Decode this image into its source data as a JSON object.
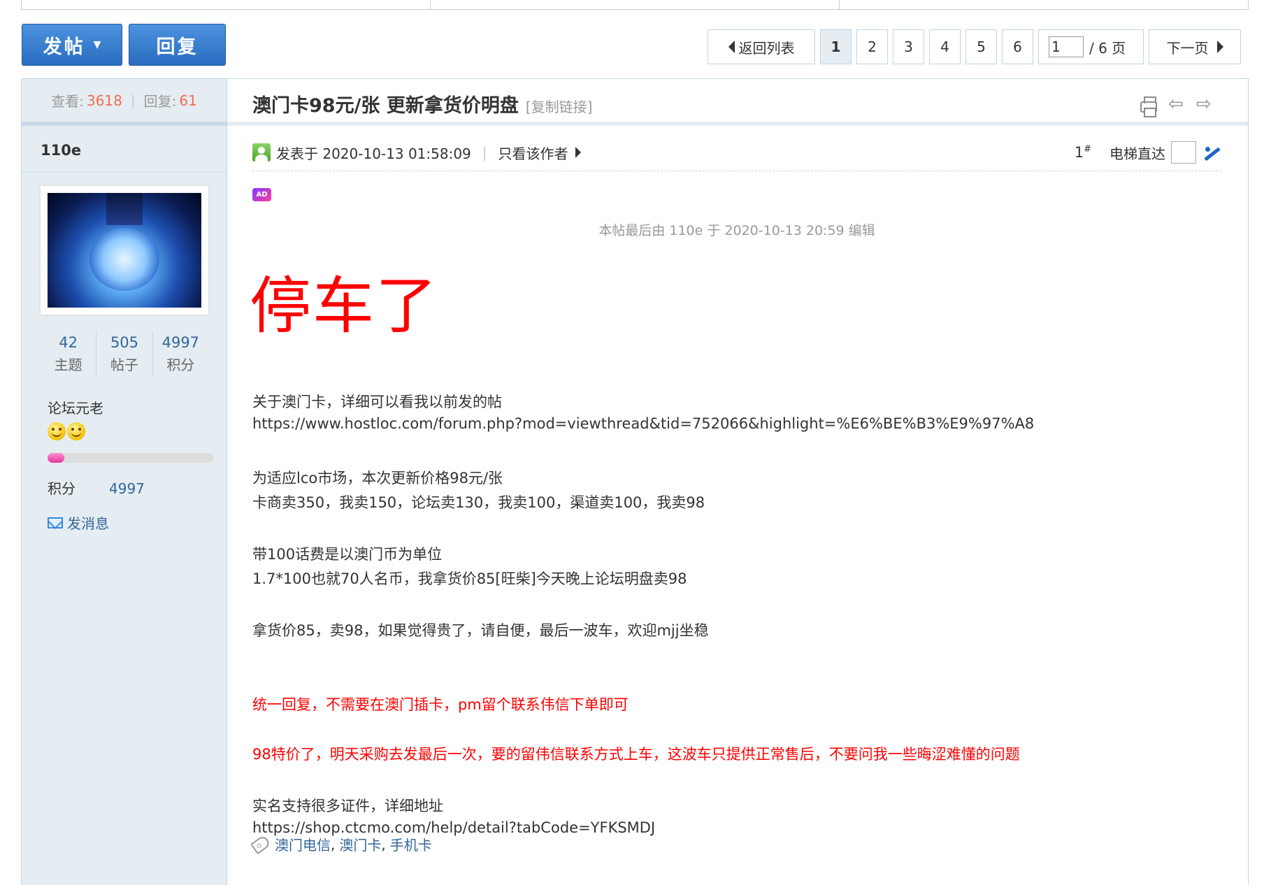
{
  "toolbar": {
    "post_label": "发帖",
    "reply_label": "回复"
  },
  "pager": {
    "back_label": "返回列表",
    "pages": [
      "1",
      "2",
      "3",
      "4",
      "5",
      "6"
    ],
    "current": "1",
    "jump_value": "1",
    "total_label": "/ 6 页",
    "next_label": "下一页"
  },
  "thread": {
    "views_label": "查看:",
    "views": "3618",
    "replies_label": "回复:",
    "replies": "61",
    "title": "澳门卡98元/张 更新拿货价明盘",
    "copy_link": "[复制链接]"
  },
  "author": {
    "name": "110e",
    "stats": [
      {
        "value": "42",
        "label": "主题"
      },
      {
        "value": "505",
        "label": "帖子"
      },
      {
        "value": "4997",
        "label": "积分"
      }
    ],
    "rank": "论坛元老",
    "level_progress": 0.1,
    "score_label": "积分",
    "score_value": "4997",
    "message_label": "发消息"
  },
  "post": {
    "posted_at": "发表于 2020-10-13 01:58:09",
    "author_only": "只看该作者",
    "floor": "1",
    "floor_sup": "#",
    "elevator_label": "电梯直达",
    "ad_badge": "AD",
    "edited_note": "本帖最后由 110e 于 2020-10-13 20:59 编辑",
    "headline": "停车了",
    "lines": [
      {
        "text": "关于澳门卡，详细可以看我以前发的帖",
        "red": false
      },
      {
        "text": "https://www.hostloc.com/forum.php?mod=viewthread&tid=752066&highlight=%E6%BE%B3%E9%97%A8",
        "red": false
      },
      {
        "text": "为适应lco市场，本次更新价格98元/张",
        "red": false
      },
      {
        "text": "卡商卖350，我卖150，论坛卖130，我卖100，渠道卖100，我卖98",
        "red": false
      },
      {
        "text": "带100话费是以澳门币为单位",
        "red": false
      },
      {
        "text": "1.7*100也就70人名币，我拿货价85[旺柴]今天晚上论坛明盘卖98",
        "red": false
      },
      {
        "text": "拿货价85，卖98，如果觉得贵了，请自便，最后一波车，欢迎mjj坐稳",
        "red": false
      },
      {
        "text": "统一回复，不需要在澳门插卡，pm留个联系伟信下单即可",
        "red": true
      },
      {
        "text": "98特价了，明天采购去发最后一次，要的留伟信联系方式上车，这波车只提供正常售后，不要问我一些晦涩难懂的问题",
        "red": true
      },
      {
        "text": "实名支持很多证件，详细地址",
        "red": false
      },
      {
        "text": "https://shop.ctcmo.com/help/detail?tabCode=YFKSMDJ",
        "red": false
      }
    ],
    "tags": [
      "澳门电信",
      "澳门卡",
      "手机卡"
    ]
  }
}
